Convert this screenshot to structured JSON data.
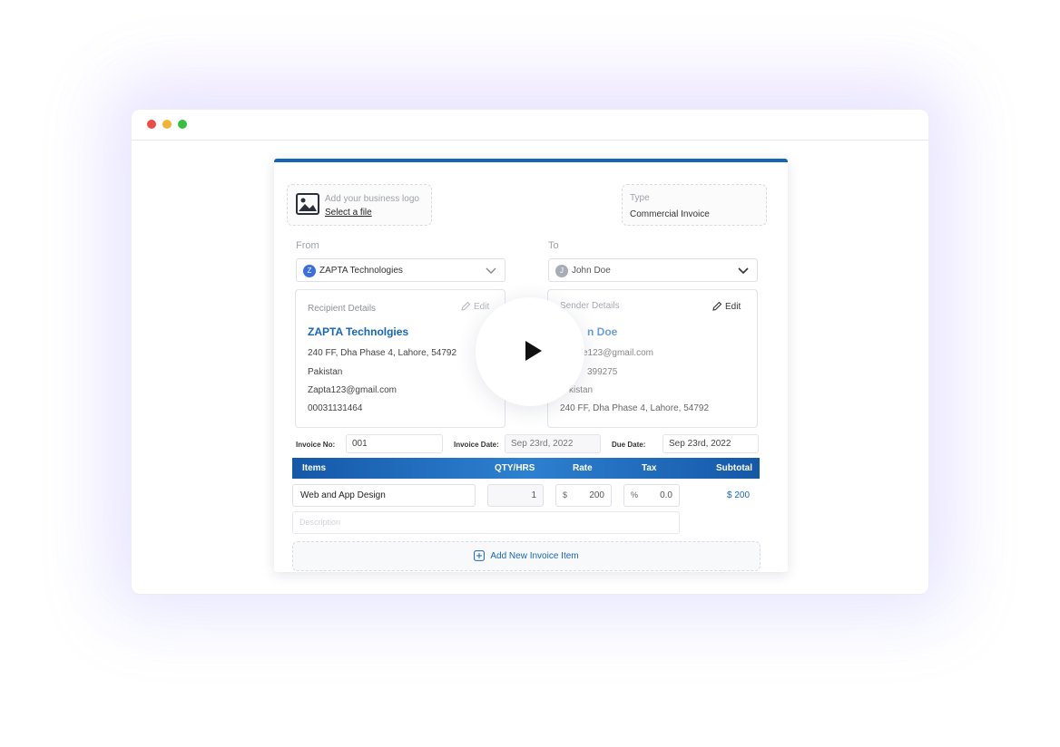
{
  "window": {
    "controls": [
      "close",
      "minimize",
      "maximize"
    ]
  },
  "logo_upload": {
    "hint": "Add your business logo",
    "link": "Select a file"
  },
  "invoice_type": {
    "label": "Type",
    "value": "Commercial Invoice"
  },
  "from": {
    "label": "From",
    "selected": "ZAPTA Technologies",
    "avatar_initial": "Z",
    "details": {
      "title": "Recipient Details",
      "edit_label": "Edit",
      "name": "ZAPTA Technolgies",
      "address": "240 FF, Dha Phase 4, Lahore, 54792",
      "country": "Pakistan",
      "email": "Zapta123@gmail.com",
      "phone": "00031131464"
    }
  },
  "to": {
    "label": "To",
    "selected": "John Doe",
    "avatar_initial": "J",
    "details": {
      "title": "Sender Details",
      "edit_label": "Edit",
      "name_visible": "n Doe",
      "email_visible": "e123@gmail.com",
      "phone_visible": "399275",
      "country_visible": "kistan",
      "address": "240 FF, Dha Phase 4, Lahore, 54792"
    }
  },
  "meta": {
    "invoice_no_label": "Invoice No:",
    "invoice_no": "001",
    "invoice_date_label": "Invoice Date:",
    "invoice_date": "Sep 23rd, 2022",
    "due_date_label": "Due Date:",
    "due_date": "Sep 23rd, 2022"
  },
  "items_table": {
    "columns": [
      "Items",
      "QTY/HRS",
      "Rate",
      "Tax",
      "Subtotal"
    ],
    "rows": [
      {
        "item": "Web and App Design",
        "qty": "1",
        "rate_prefix": "$",
        "rate": "200",
        "tax_prefix": "%",
        "tax": "0.0",
        "subtotal": "$ 200",
        "description_placeholder": "Description"
      }
    ],
    "add_label": "Add New Invoice Item"
  },
  "colors": {
    "accent": "#1766b6",
    "traffic_red": "#ee4b43",
    "traffic_yellow": "#f3b22f",
    "traffic_green": "#35c13f",
    "from_avatar": "#3b6fe0",
    "to_avatar": "#a8acb6"
  },
  "icons": [
    "image-icon",
    "chevron-down-icon",
    "pencil-icon",
    "play-icon",
    "plus-square-icon"
  ]
}
